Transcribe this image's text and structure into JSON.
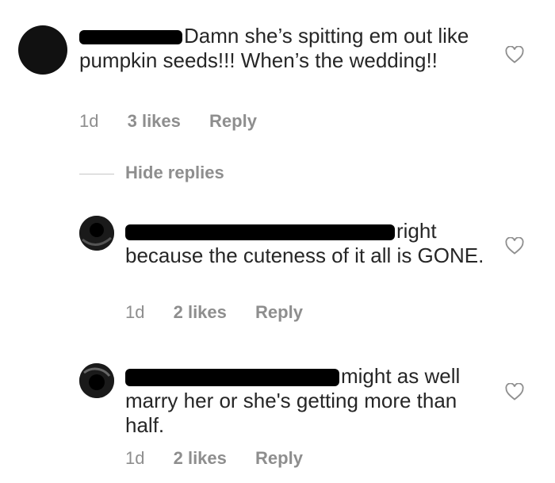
{
  "comments": [
    {
      "text": "Damn she’s spitting em out like pumpkin seeds!!! When’s the wedding!!",
      "time": "1d",
      "likes": "3 likes",
      "reply": "Reply"
    }
  ],
  "hide_replies": "Hide replies",
  "replies": [
    {
      "text": "right because the cuteness of it all is GONE.",
      "time": "1d",
      "likes": "2 likes",
      "reply": "Reply"
    },
    {
      "text": "might as well marry her or she's getting more than half.",
      "time": "1d",
      "likes": "2 likes",
      "reply": "Reply"
    }
  ],
  "icons": {
    "like": "heart-outline-icon",
    "avatar": "profile-avatar"
  }
}
